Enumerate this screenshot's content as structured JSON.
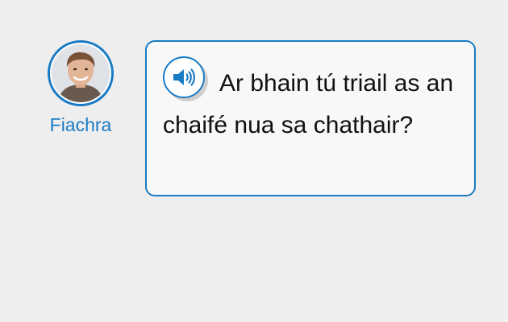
{
  "speaker": {
    "name": "Fiachra"
  },
  "message": {
    "text": "Ar bhain tú triail as an chaifé nua sa chathair?",
    "audio_icon": "speaker-volume-icon"
  },
  "colors": {
    "accent": "#1a7bc4",
    "background": "#eeeeee",
    "bubble": "#f8f8f8"
  }
}
